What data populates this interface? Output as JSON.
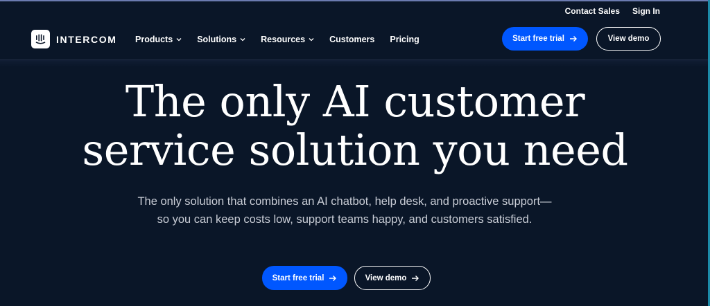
{
  "utility": {
    "contact_sales": "Contact Sales",
    "sign_in": "Sign In"
  },
  "brand": {
    "name": "INTERCOM",
    "logo_icon": "intercom-logo-icon"
  },
  "nav": {
    "items": [
      {
        "label": "Products",
        "has_dropdown": true
      },
      {
        "label": "Solutions",
        "has_dropdown": true
      },
      {
        "label": "Resources",
        "has_dropdown": true
      },
      {
        "label": "Customers",
        "has_dropdown": false
      },
      {
        "label": "Pricing",
        "has_dropdown": false
      }
    ],
    "cta_primary": "Start free trial",
    "cta_secondary": "View demo"
  },
  "hero": {
    "headline_line1": "The only AI customer",
    "headline_line2": "service solution you need",
    "subhead": "The only solution that combines an AI chatbot, help desk, and proactive support—so you can keep costs low, support teams happy, and customers satisfied.",
    "cta_primary": "Start free trial",
    "cta_secondary": "View demo"
  },
  "colors": {
    "background": "#0a1628",
    "accent": "#0057ff",
    "text": "#ffffff",
    "muted_text": "#c9cdd6"
  }
}
